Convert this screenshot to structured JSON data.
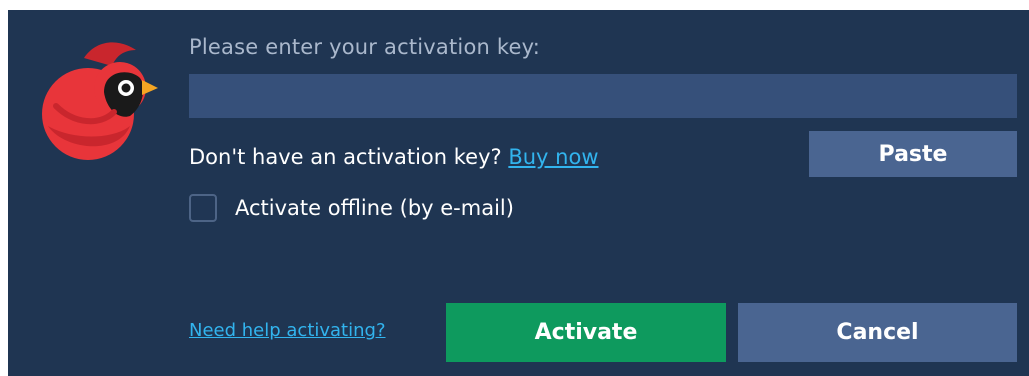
{
  "dialog": {
    "prompt": "Please enter your activation key:",
    "key_input": {
      "value": "",
      "placeholder": ""
    },
    "no_key_text": "Don't have an activation key?",
    "buy_now_label": "Buy now",
    "paste_label": "Paste",
    "offline_checkbox": {
      "label": "Activate offline (by e-mail)",
      "checked": false
    },
    "help_link_label": "Need help activating?",
    "activate_label": "Activate",
    "cancel_label": "Cancel"
  },
  "icons": {
    "logo": "cardinal-bird-logo-icon",
    "checkbox": "checkbox-unchecked-icon"
  },
  "colors": {
    "background": "#1f3552",
    "input": "#36507a",
    "secondary_button": "#4a6591",
    "primary_button": "#0e9a5e",
    "link": "#32b4ee",
    "prompt_text": "#aab8cc",
    "logo_red": "#e8353a"
  }
}
